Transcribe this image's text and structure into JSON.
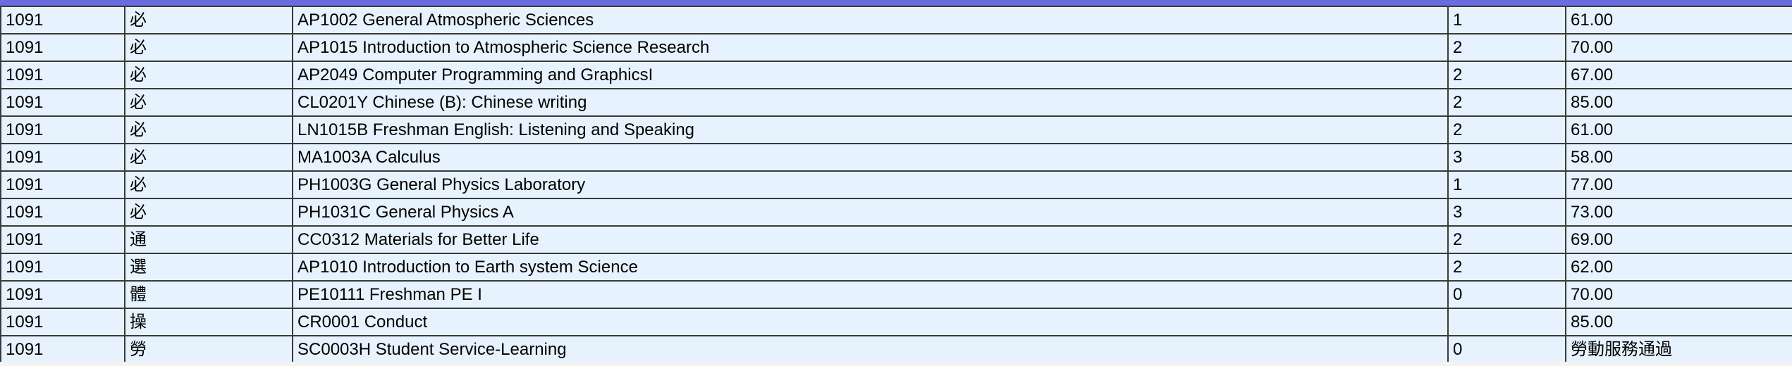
{
  "rows": [
    {
      "semester": "1091",
      "type": "必",
      "course": "AP1002 General Atmospheric Sciences",
      "credits": "1",
      "score": "61.00"
    },
    {
      "semester": "1091",
      "type": "必",
      "course": "AP1015 Introduction to Atmospheric Science Research",
      "credits": "2",
      "score": "70.00"
    },
    {
      "semester": "1091",
      "type": "必",
      "course": "AP2049 Computer Programming and GraphicsI",
      "credits": "2",
      "score": "67.00"
    },
    {
      "semester": "1091",
      "type": "必",
      "course": "CL0201Y Chinese (B): Chinese writing",
      "credits": "2",
      "score": "85.00"
    },
    {
      "semester": "1091",
      "type": "必",
      "course": "LN1015B Freshman English: Listening and Speaking",
      "credits": "2",
      "score": "61.00"
    },
    {
      "semester": "1091",
      "type": "必",
      "course": "MA1003A Calculus",
      "credits": "3",
      "score": "58.00"
    },
    {
      "semester": "1091",
      "type": "必",
      "course": "PH1003G General Physics Laboratory",
      "credits": "1",
      "score": "77.00"
    },
    {
      "semester": "1091",
      "type": "必",
      "course": "PH1031C General Physics A",
      "credits": "3",
      "score": "73.00"
    },
    {
      "semester": "1091",
      "type": "通",
      "course": "CC0312 Materials for Better Life",
      "credits": "2",
      "score": "69.00"
    },
    {
      "semester": "1091",
      "type": "選",
      "course": "AP1010 Introduction to Earth system Science",
      "credits": "2",
      "score": "62.00"
    },
    {
      "semester": "1091",
      "type": "體",
      "course": "PE10111 Freshman PE I",
      "credits": "0",
      "score": "70.00"
    },
    {
      "semester": "1091",
      "type": "操",
      "course": "CR0001 Conduct",
      "credits": "",
      "score": "85.00"
    },
    {
      "semester": "1091",
      "type": "勞",
      "course": "SC0003H Student Service-Learning",
      "credits": "0",
      "score": "勞動服務通過"
    }
  ]
}
